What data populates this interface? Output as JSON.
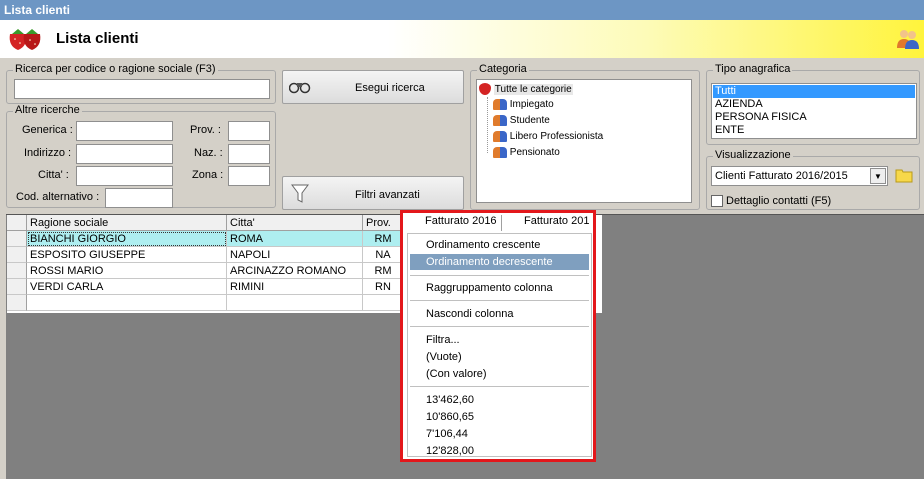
{
  "window": {
    "title": "Lista clienti"
  },
  "header": {
    "title": "Lista clienti"
  },
  "search": {
    "legend": "Ricerca per codice o ragione sociale (F3)",
    "value": "",
    "button_label": "Esegui ricerca"
  },
  "other_searches": {
    "legend": "Altre ricerche",
    "labels": {
      "generica": "Generica :",
      "indirizzo": "Indirizzo :",
      "citta": "Citta' :",
      "cod_alt": "Cod. alternativo :",
      "prov": "Prov. :",
      "naz": "Naz. :",
      "zona": "Zona :"
    },
    "advanced_button_label": "Filtri avanzati"
  },
  "categoria": {
    "legend": "Categoria",
    "root": "Tutte le categorie",
    "items": [
      "Impiegato",
      "Studente",
      "Libero Professionista",
      "Pensionato"
    ]
  },
  "tipo_anagrafica": {
    "legend": "Tipo anagrafica",
    "items": [
      "Tutti",
      "AZIENDA",
      "PERSONA FISICA",
      "ENTE"
    ],
    "selected": 0
  },
  "visualizzazione": {
    "legend": "Visualizzazione",
    "selected": "Clienti Fatturato 2016/2015",
    "checkbox_label": "Dettaglio contatti (F5)",
    "checked": false
  },
  "grid": {
    "columns": [
      "Ragione sociale",
      "Citta'",
      "Prov."
    ],
    "rows": [
      [
        "BIANCHI GIORGIO",
        "ROMA",
        "RM"
      ],
      [
        "ESPOSITO GIUSEPPE",
        "NAPOLI",
        "NA"
      ],
      [
        "ROSSI MARIO",
        "ARCINAZZO ROMANO",
        "RM"
      ],
      [
        "VERDI CARLA",
        "RIMINI",
        "RN"
      ]
    ],
    "selected_row": 0
  },
  "context_menu": {
    "column_headers": [
      "Fatturato 2016",
      "Fatturato 201"
    ],
    "sort_asc": "Ordinamento crescente",
    "sort_desc": "Ordinamento decrescente",
    "group": "Raggruppamento colonna",
    "hide": "Nascondi colonna",
    "filter": "Filtra...",
    "empty": "(Vuote)",
    "with_value": "(Con valore)",
    "values": [
      "13'462,60",
      "10'860,65",
      "7'106,44",
      "12'828,00"
    ]
  },
  "colors": {
    "title_bar": "#6d96c4",
    "highlight_menu": "#7f9fbf",
    "row_highlight": "#aeeef0",
    "callout": "#e3171b"
  }
}
